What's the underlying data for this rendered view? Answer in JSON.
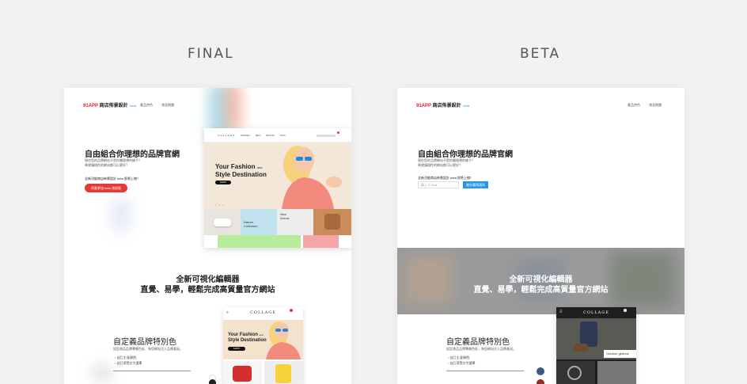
{
  "columns": {
    "final_label": "FINAL",
    "beta_label": "BETA"
  },
  "header": {
    "logo_mark": "91APP",
    "logo_text": "商店佈景設計",
    "logo_tag": "beta",
    "nav": [
      "產品特色",
      "常見問題"
    ]
  },
  "hero": {
    "title": "自由組合你理想的品牌官網",
    "subtitle_1": "現在您的品牌網站不是你最理想的樣子？",
    "subtitle_2": "希望讓個性的網站都可以更好？",
    "launch_text": "全新功能商店佈景設計 beta 即將上線！",
    "final_cta": "同意參加 beta 測試版",
    "email_placeholder": "輸入 E-Mail",
    "beta_cta": "搶先獲得通知"
  },
  "preview": {
    "logo": "COLLAGE",
    "nav": [
      "WOMEN",
      "MEN",
      "BRAND",
      "KIDS"
    ],
    "banner_line1": "Your Fashion",
    "banner_and": "and",
    "banner_line2": "Style Destination",
    "banner_btn": "SHOP",
    "dots": "• • •",
    "tile_1": "Nature",
    "tile_1b": "Collection",
    "tile_2": "New",
    "tile_2b": "Arrival"
  },
  "editor_section": {
    "line1": "全新可視化編輯器",
    "line2": "直覺、易學，輕鬆完成高質量官方網站"
  },
  "brand_section": {
    "title": "自定義品牌特別色",
    "subtitle": "設定商品品牌專屬色彩，為您網站注入品牌基因。",
    "items": [
      "自訂主/副顏色",
      "自訂導覽文字選單"
    ]
  },
  "mock_final": {
    "logo": "COLLAGE",
    "line1": "Your Fashion",
    "and": "and",
    "line2": "Style Destination",
    "btn": "SHOP"
  },
  "mock_beta": {
    "logo": "COLLAGE",
    "caption": "Outdoor gears ▸"
  },
  "colors": {
    "red": "#e53935",
    "blue": "#2196f3"
  }
}
